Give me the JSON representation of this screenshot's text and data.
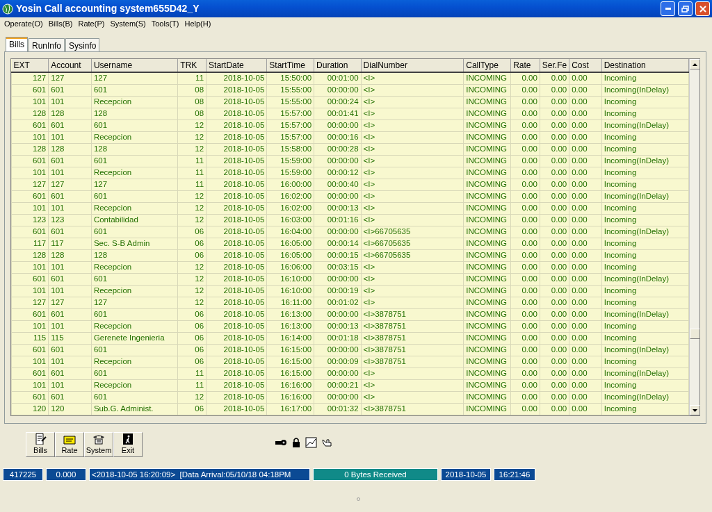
{
  "window": {
    "title": "Yosin Call accounting system655D42_Y"
  },
  "menu": [
    "Operate(O)",
    "Bills(B)",
    "Rate(P)",
    "System(S)",
    "Tools(T)",
    "Help(H)"
  ],
  "tabs": [
    {
      "label": "Bills",
      "selected": true
    },
    {
      "label": "RunInfo",
      "selected": false
    },
    {
      "label": "Sysinfo",
      "selected": false
    }
  ],
  "table": {
    "columns": [
      "EXT",
      "Account",
      "Username",
      "TRK",
      "StartDate",
      "StartTime",
      "Duration",
      "DialNumber",
      "CallType",
      "Rate",
      "Ser.Fe",
      "Cost",
      "Destination"
    ],
    "rows": [
      [
        "127",
        "127",
        "127",
        "11",
        "2018-10-05",
        "15:50:00",
        "00:01:00",
        "<I>",
        "INCOMING",
        "0.00",
        "0.00",
        "0.00",
        "Incoming"
      ],
      [
        "601",
        "601",
        "601",
        "08",
        "2018-10-05",
        "15:55:00",
        "00:00:00",
        "<I>",
        "INCOMING",
        "0.00",
        "0.00",
        "0.00",
        "Incoming(InDelay)"
      ],
      [
        "101",
        "101",
        "Recepcion",
        "08",
        "2018-10-05",
        "15:55:00",
        "00:00:24",
        "<I>",
        "INCOMING",
        "0.00",
        "0.00",
        "0.00",
        "Incoming"
      ],
      [
        "128",
        "128",
        "128",
        "08",
        "2018-10-05",
        "15:57:00",
        "00:01:41",
        "<I>",
        "INCOMING",
        "0.00",
        "0.00",
        "0.00",
        "Incoming"
      ],
      [
        "601",
        "601",
        "601",
        "12",
        "2018-10-05",
        "15:57:00",
        "00:00:00",
        "<I>",
        "INCOMING",
        "0.00",
        "0.00",
        "0.00",
        "Incoming(InDelay)"
      ],
      [
        "101",
        "101",
        "Recepcion",
        "12",
        "2018-10-05",
        "15:57:00",
        "00:00:16",
        "<I>",
        "INCOMING",
        "0.00",
        "0.00",
        "0.00",
        "Incoming"
      ],
      [
        "128",
        "128",
        "128",
        "12",
        "2018-10-05",
        "15:58:00",
        "00:00:28",
        "<I>",
        "INCOMING",
        "0.00",
        "0.00",
        "0.00",
        "Incoming"
      ],
      [
        "601",
        "601",
        "601",
        "11",
        "2018-10-05",
        "15:59:00",
        "00:00:00",
        "<I>",
        "INCOMING",
        "0.00",
        "0.00",
        "0.00",
        "Incoming(InDelay)"
      ],
      [
        "101",
        "101",
        "Recepcion",
        "11",
        "2018-10-05",
        "15:59:00",
        "00:00:12",
        "<I>",
        "INCOMING",
        "0.00",
        "0.00",
        "0.00",
        "Incoming"
      ],
      [
        "127",
        "127",
        "127",
        "11",
        "2018-10-05",
        "16:00:00",
        "00:00:40",
        "<I>",
        "INCOMING",
        "0.00",
        "0.00",
        "0.00",
        "Incoming"
      ],
      [
        "601",
        "601",
        "601",
        "12",
        "2018-10-05",
        "16:02:00",
        "00:00:00",
        "<I>",
        "INCOMING",
        "0.00",
        "0.00",
        "0.00",
        "Incoming(InDelay)"
      ],
      [
        "101",
        "101",
        "Recepcion",
        "12",
        "2018-10-05",
        "16:02:00",
        "00:00:13",
        "<I>",
        "INCOMING",
        "0.00",
        "0.00",
        "0.00",
        "Incoming"
      ],
      [
        "123",
        "123",
        "Contabilidad",
        "12",
        "2018-10-05",
        "16:03:00",
        "00:01:16",
        "<I>",
        "INCOMING",
        "0.00",
        "0.00",
        "0.00",
        "Incoming"
      ],
      [
        "601",
        "601",
        "601",
        "06",
        "2018-10-05",
        "16:04:00",
        "00:00:00",
        "<I>66705635",
        "INCOMING",
        "0.00",
        "0.00",
        "0.00",
        "Incoming(InDelay)"
      ],
      [
        "117",
        "117",
        "Sec. S-B Admin",
        "06",
        "2018-10-05",
        "16:05:00",
        "00:00:14",
        "<I>66705635",
        "INCOMING",
        "0.00",
        "0.00",
        "0.00",
        "Incoming"
      ],
      [
        "128",
        "128",
        "128",
        "06",
        "2018-10-05",
        "16:05:00",
        "00:00:15",
        "<I>66705635",
        "INCOMING",
        "0.00",
        "0.00",
        "0.00",
        "Incoming"
      ],
      [
        "101",
        "101",
        "Recepcion",
        "12",
        "2018-10-05",
        "16:06:00",
        "00:03:15",
        "<I>",
        "INCOMING",
        "0.00",
        "0.00",
        "0.00",
        "Incoming"
      ],
      [
        "601",
        "601",
        "601",
        "12",
        "2018-10-05",
        "16:10:00",
        "00:00:00",
        "<I>",
        "INCOMING",
        "0.00",
        "0.00",
        "0.00",
        "Incoming(InDelay)"
      ],
      [
        "101",
        "101",
        "Recepcion",
        "12",
        "2018-10-05",
        "16:10:00",
        "00:00:19",
        "<I>",
        "INCOMING",
        "0.00",
        "0.00",
        "0.00",
        "Incoming"
      ],
      [
        "127",
        "127",
        "127",
        "12",
        "2018-10-05",
        "16:11:00",
        "00:01:02",
        "<I>",
        "INCOMING",
        "0.00",
        "0.00",
        "0.00",
        "Incoming"
      ],
      [
        "601",
        "601",
        "601",
        "06",
        "2018-10-05",
        "16:13:00",
        "00:00:00",
        "<I>3878751",
        "INCOMING",
        "0.00",
        "0.00",
        "0.00",
        "Incoming(InDelay)"
      ],
      [
        "101",
        "101",
        "Recepcion",
        "06",
        "2018-10-05",
        "16:13:00",
        "00:00:13",
        "<I>3878751",
        "INCOMING",
        "0.00",
        "0.00",
        "0.00",
        "Incoming"
      ],
      [
        "115",
        "115",
        "Gerenete Ingenieria",
        "06",
        "2018-10-05",
        "16:14:00",
        "00:01:18",
        "<I>3878751",
        "INCOMING",
        "0.00",
        "0.00",
        "0.00",
        "Incoming"
      ],
      [
        "601",
        "601",
        "601",
        "06",
        "2018-10-05",
        "16:15:00",
        "00:00:00",
        "<I>3878751",
        "INCOMING",
        "0.00",
        "0.00",
        "0.00",
        "Incoming(InDelay)"
      ],
      [
        "101",
        "101",
        "Recepcion",
        "06",
        "2018-10-05",
        "16:15:00",
        "00:00:09",
        "<I>3878751",
        "INCOMING",
        "0.00",
        "0.00",
        "0.00",
        "Incoming"
      ],
      [
        "601",
        "601",
        "601",
        "11",
        "2018-10-05",
        "16:15:00",
        "00:00:00",
        "<I>",
        "INCOMING",
        "0.00",
        "0.00",
        "0.00",
        "Incoming(InDelay)"
      ],
      [
        "101",
        "101",
        "Recepcion",
        "11",
        "2018-10-05",
        "16:16:00",
        "00:00:21",
        "<I>",
        "INCOMING",
        "0.00",
        "0.00",
        "0.00",
        "Incoming"
      ],
      [
        "601",
        "601",
        "601",
        "12",
        "2018-10-05",
        "16:16:00",
        "00:00:00",
        "<I>",
        "INCOMING",
        "0.00",
        "0.00",
        "0.00",
        "Incoming(InDelay)"
      ],
      [
        "120",
        "120",
        "Sub.G. Administ.",
        "06",
        "2018-10-05",
        "16:17:00",
        "00:01:32",
        "<I>3878751",
        "INCOMING",
        "0.00",
        "0.00",
        "0.00",
        "Incoming"
      ]
    ]
  },
  "toolbar": [
    "Bills",
    "Rate",
    "System",
    "Exit"
  ],
  "status_bar": [
    {
      "text": "417225",
      "color": "#0b4a94"
    },
    {
      "text": "0.000",
      "color": "#0b4a94"
    },
    {
      "text": "<2018-10-05 16:20:09>  [Data Arrival:05/10/18 04:18PM",
      "color": "#0b4a94"
    },
    {
      "text": "0 Bytes Received",
      "color": "#108a88"
    },
    {
      "text": "2018-10-05",
      "color": "#0b4a94"
    },
    {
      "text": "16:21:46",
      "color": "#0b4a94"
    }
  ]
}
